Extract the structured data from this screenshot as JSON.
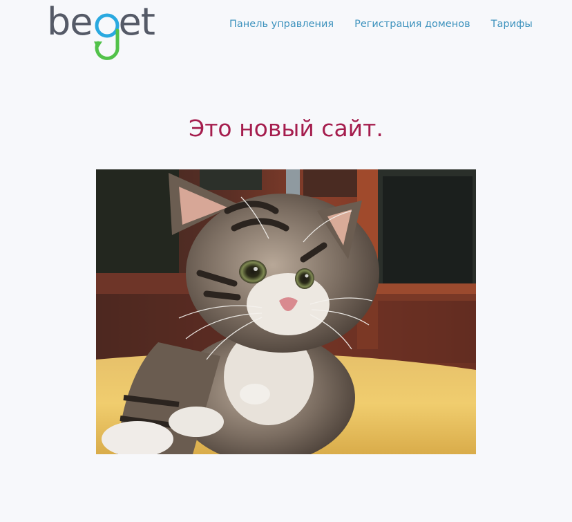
{
  "header": {
    "logo": {
      "text": "beget",
      "colors": {
        "text": "#555a67",
        "g_top": "#2aa9e0",
        "g_bottom": "#52c24a"
      }
    },
    "nav": [
      {
        "label": "Панель управления"
      },
      {
        "label": "Регистрация доменов"
      },
      {
        "label": "Тарифы"
      }
    ]
  },
  "main": {
    "title": "Это новый сайт.",
    "image": {
      "subject": "kitten-photo"
    }
  },
  "colors": {
    "background": "#f7f8fb",
    "link": "#3d92bd",
    "title": "#a51d4d"
  }
}
